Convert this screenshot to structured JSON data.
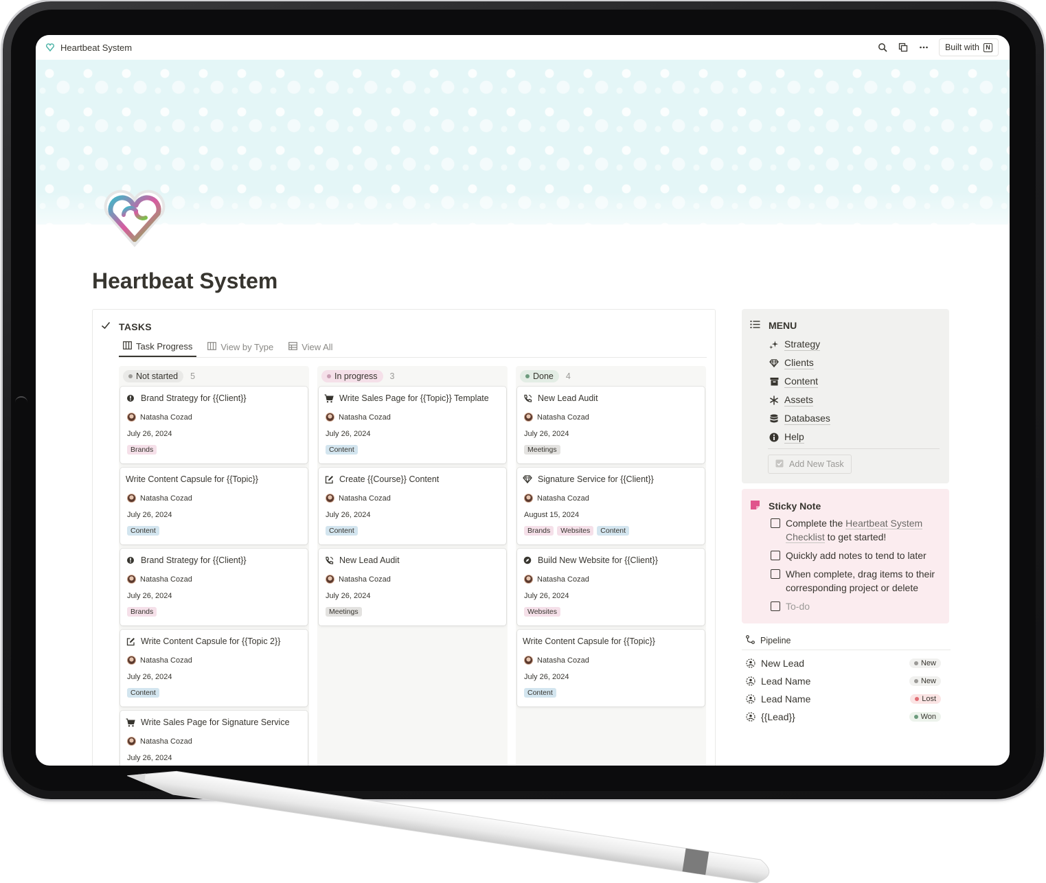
{
  "window": {
    "title": "Heartbeat System",
    "built_with": "Built with"
  },
  "page": {
    "title": "Heartbeat System"
  },
  "tasks": {
    "heading": "TASKS",
    "tabs": [
      {
        "label": "Task Progress"
      },
      {
        "label": "View by Type"
      },
      {
        "label": "View All"
      }
    ],
    "columns": [
      {
        "status": "Not started",
        "count": "5",
        "dot": "#9b9a97",
        "pill_bg": "#e9e9e7",
        "cards": [
          {
            "icon": "bug-icon",
            "title": "Brand Strategy for {{Client}}",
            "person": "Natasha Cozad",
            "date": "July 26, 2024",
            "tags": [
              "Brands"
            ]
          },
          {
            "icon": "",
            "title": "Write Content Capsule for {{Topic}}",
            "person": "Natasha Cozad",
            "date": "July 26, 2024",
            "tags": [
              "Content"
            ]
          },
          {
            "icon": "bug-icon",
            "title": "Brand Strategy for {{Client}}",
            "person": "Natasha Cozad",
            "date": "July 26, 2024",
            "tags": [
              "Brands"
            ]
          },
          {
            "icon": "edit-icon",
            "title": "Write Content Capsule for {{Topic 2}}",
            "person": "Natasha Cozad",
            "date": "July 26, 2024",
            "tags": [
              "Content"
            ]
          },
          {
            "icon": "cart-icon",
            "title": "Write Sales Page for Signature Service",
            "person": "Natasha Cozad",
            "date": "July 26, 2024",
            "tags": []
          }
        ]
      },
      {
        "status": "In progress",
        "count": "3",
        "dot": "#c9a0b4",
        "pill_bg": "#f5e0e9",
        "cards": [
          {
            "icon": "cart-icon",
            "title": "Write Sales Page for {{Topic}} Template",
            "person": "Natasha Cozad",
            "date": "July 26, 2024",
            "tags": [
              "Content"
            ]
          },
          {
            "icon": "edit-icon",
            "title": "Create {{Course}} Content",
            "person": "Natasha Cozad",
            "date": "July 26, 2024",
            "tags": [
              "Content"
            ]
          },
          {
            "icon": "phone-icon",
            "title": "New Lead Audit",
            "person": "Natasha Cozad",
            "date": "July 26, 2024",
            "tags": [
              "Meetings"
            ]
          }
        ]
      },
      {
        "status": "Done",
        "count": "4",
        "dot": "#6c9b7d",
        "pill_bg": "#e3ede5",
        "cards": [
          {
            "icon": "phone-icon",
            "title": "New Lead Audit",
            "person": "Natasha Cozad",
            "date": "July 26, 2024",
            "tags": [
              "Meetings"
            ]
          },
          {
            "icon": "gem-icon",
            "title": "Signature Service for {{Client}}",
            "person": "Natasha Cozad",
            "date": "August 15, 2024",
            "tags": [
              "Brands",
              "Websites",
              "Content"
            ]
          },
          {
            "icon": "compass-icon",
            "title": "Build New Website for {{Client}}",
            "person": "Natasha Cozad",
            "date": "July 26, 2024",
            "tags": [
              "Websites"
            ]
          },
          {
            "icon": "",
            "title": "Write Content Capsule for {{Topic}}",
            "person": "Natasha Cozad",
            "date": "July 26, 2024",
            "tags": [
              "Content"
            ]
          }
        ]
      }
    ]
  },
  "menu": {
    "heading": "MENU",
    "items": [
      {
        "icon": "sparkles-icon",
        "label": "Strategy"
      },
      {
        "icon": "gem-icon",
        "label": "Clients"
      },
      {
        "icon": "archive-icon",
        "label": "Content"
      },
      {
        "icon": "asterisk-icon",
        "label": "Assets"
      },
      {
        "icon": "database-icon",
        "label": "Databases"
      },
      {
        "icon": "info-icon",
        "label": "Help"
      }
    ],
    "add_task": "Add New Task"
  },
  "sticky": {
    "heading": "Sticky Note",
    "todos": [
      {
        "pre": "Complete the ",
        "link": "Heartbeat System Checklist",
        "post": " to get started!"
      },
      {
        "text": "Quickly add notes to tend to later"
      },
      {
        "text": "When complete, drag items to their corresponding project or delete"
      },
      {
        "placeholder": "To-do"
      }
    ]
  },
  "pipeline": {
    "heading": "Pipeline",
    "rows": [
      {
        "name": "New Lead",
        "status": "New",
        "dot": "#9b9a97"
      },
      {
        "name": "Lead Name",
        "status": "New",
        "dot": "#9b9a97"
      },
      {
        "name": "Lead Name",
        "status": "Lost",
        "dot": "#e16f76"
      },
      {
        "name": "{{Lead}}",
        "status": "Won",
        "dot": "#6c9b7d"
      }
    ]
  }
}
